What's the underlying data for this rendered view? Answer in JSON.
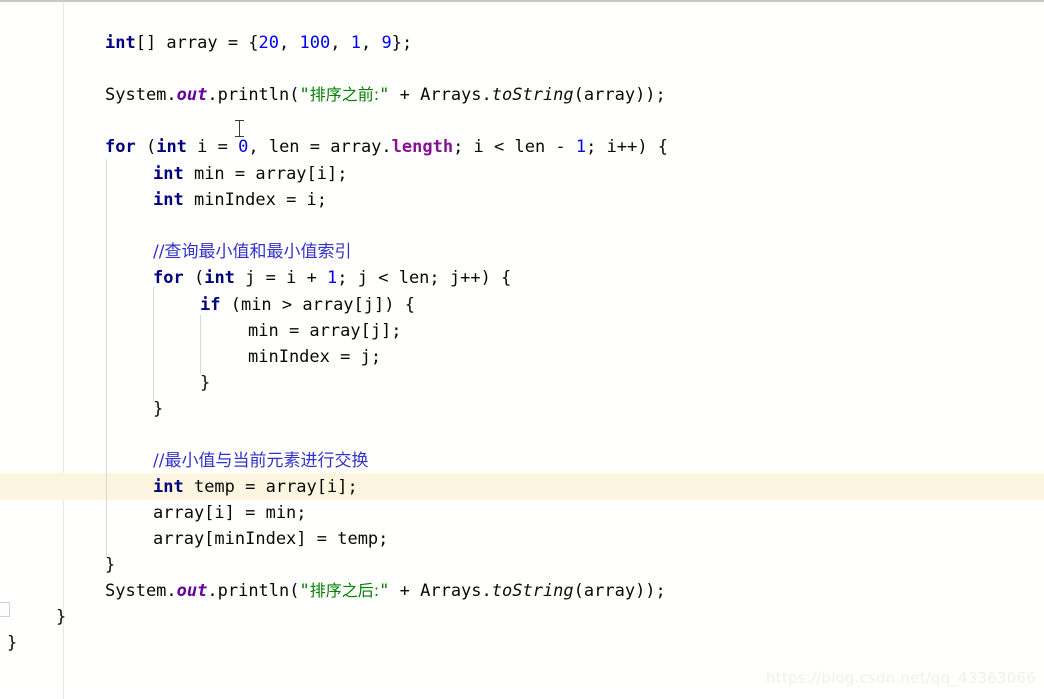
{
  "editor": {
    "language": "Java",
    "watermark": "https://blog.csdn.net/qq_43363066",
    "cursor_icon": "text-ibeam-cursor",
    "colors": {
      "background": "#fffffe",
      "keyword": "#000080",
      "number": "#0000ff",
      "string": "#008000",
      "static_field": "#660099",
      "property": "#871094",
      "comment": "#3333cc",
      "current_line_highlight": "#fcf6e0",
      "gutter_rule": "#e8e8e8",
      "indent_guide": "#d9d9d9",
      "watermark": "#efefef"
    }
  },
  "code": {
    "line01": {
      "kw_int": "int",
      "t1": "[] array = {",
      "n20": "20",
      "t2": ", ",
      "n100": "100",
      "t3": ", ",
      "n1": "1",
      "t4": ", ",
      "n9": "9",
      "t5": "};"
    },
    "line03": {
      "t1": "System.",
      "field_out": "out",
      "t2": ".println(",
      "quote_open": "\"",
      "cjk": "排序之前:",
      "quote_close": "\"",
      "t3": " + Arrays.",
      "method": "toString",
      "t4": "(array));"
    },
    "line05": {
      "kw_for": "for",
      "t1": " (",
      "kw_int": "int",
      "t2": " i = ",
      "n0": "0",
      "t3": ", len = array.",
      "prop_length": "length",
      "t4": "; i < len - ",
      "n1": "1",
      "t5": "; i++) {"
    },
    "line06": {
      "kw_int": "int",
      "rest": " min = array[i];"
    },
    "line07": {
      "kw_int": "int",
      "rest": " minIndex = i;"
    },
    "line09": {
      "comment": "//查询最小值和最小值索引"
    },
    "line10": {
      "kw_for": "for",
      "t1": " (",
      "kw_int": "int",
      "t2": " j = i + ",
      "n1": "1",
      "t3": "; j < len; j++) {"
    },
    "line11": {
      "kw_if": "if",
      "rest": " (min > array[j]) {"
    },
    "line12": {
      "text": "min = array[j];"
    },
    "line13": {
      "text": "minIndex = j;"
    },
    "line14": {
      "text": "}"
    },
    "line15": {
      "text": "}"
    },
    "line17": {
      "comment": "//最小值与当前元素进行交换"
    },
    "line18": {
      "kw_int": "int",
      "rest": " temp = array[i];"
    },
    "line19": {
      "text": "array[i] = min;"
    },
    "line20": {
      "text": "array[minIndex] = temp;"
    },
    "line21": {
      "text": "}"
    },
    "line22": {
      "t1": "System.",
      "field_out": "out",
      "t2": ".println(",
      "quote_open": "\"",
      "cjk": "排序之后:",
      "quote_close": "\"",
      "t3": " + Arrays.",
      "method": "toString",
      "t4": "(array));"
    },
    "line23": {
      "text": "}"
    },
    "line24": {
      "text": "}"
    }
  }
}
